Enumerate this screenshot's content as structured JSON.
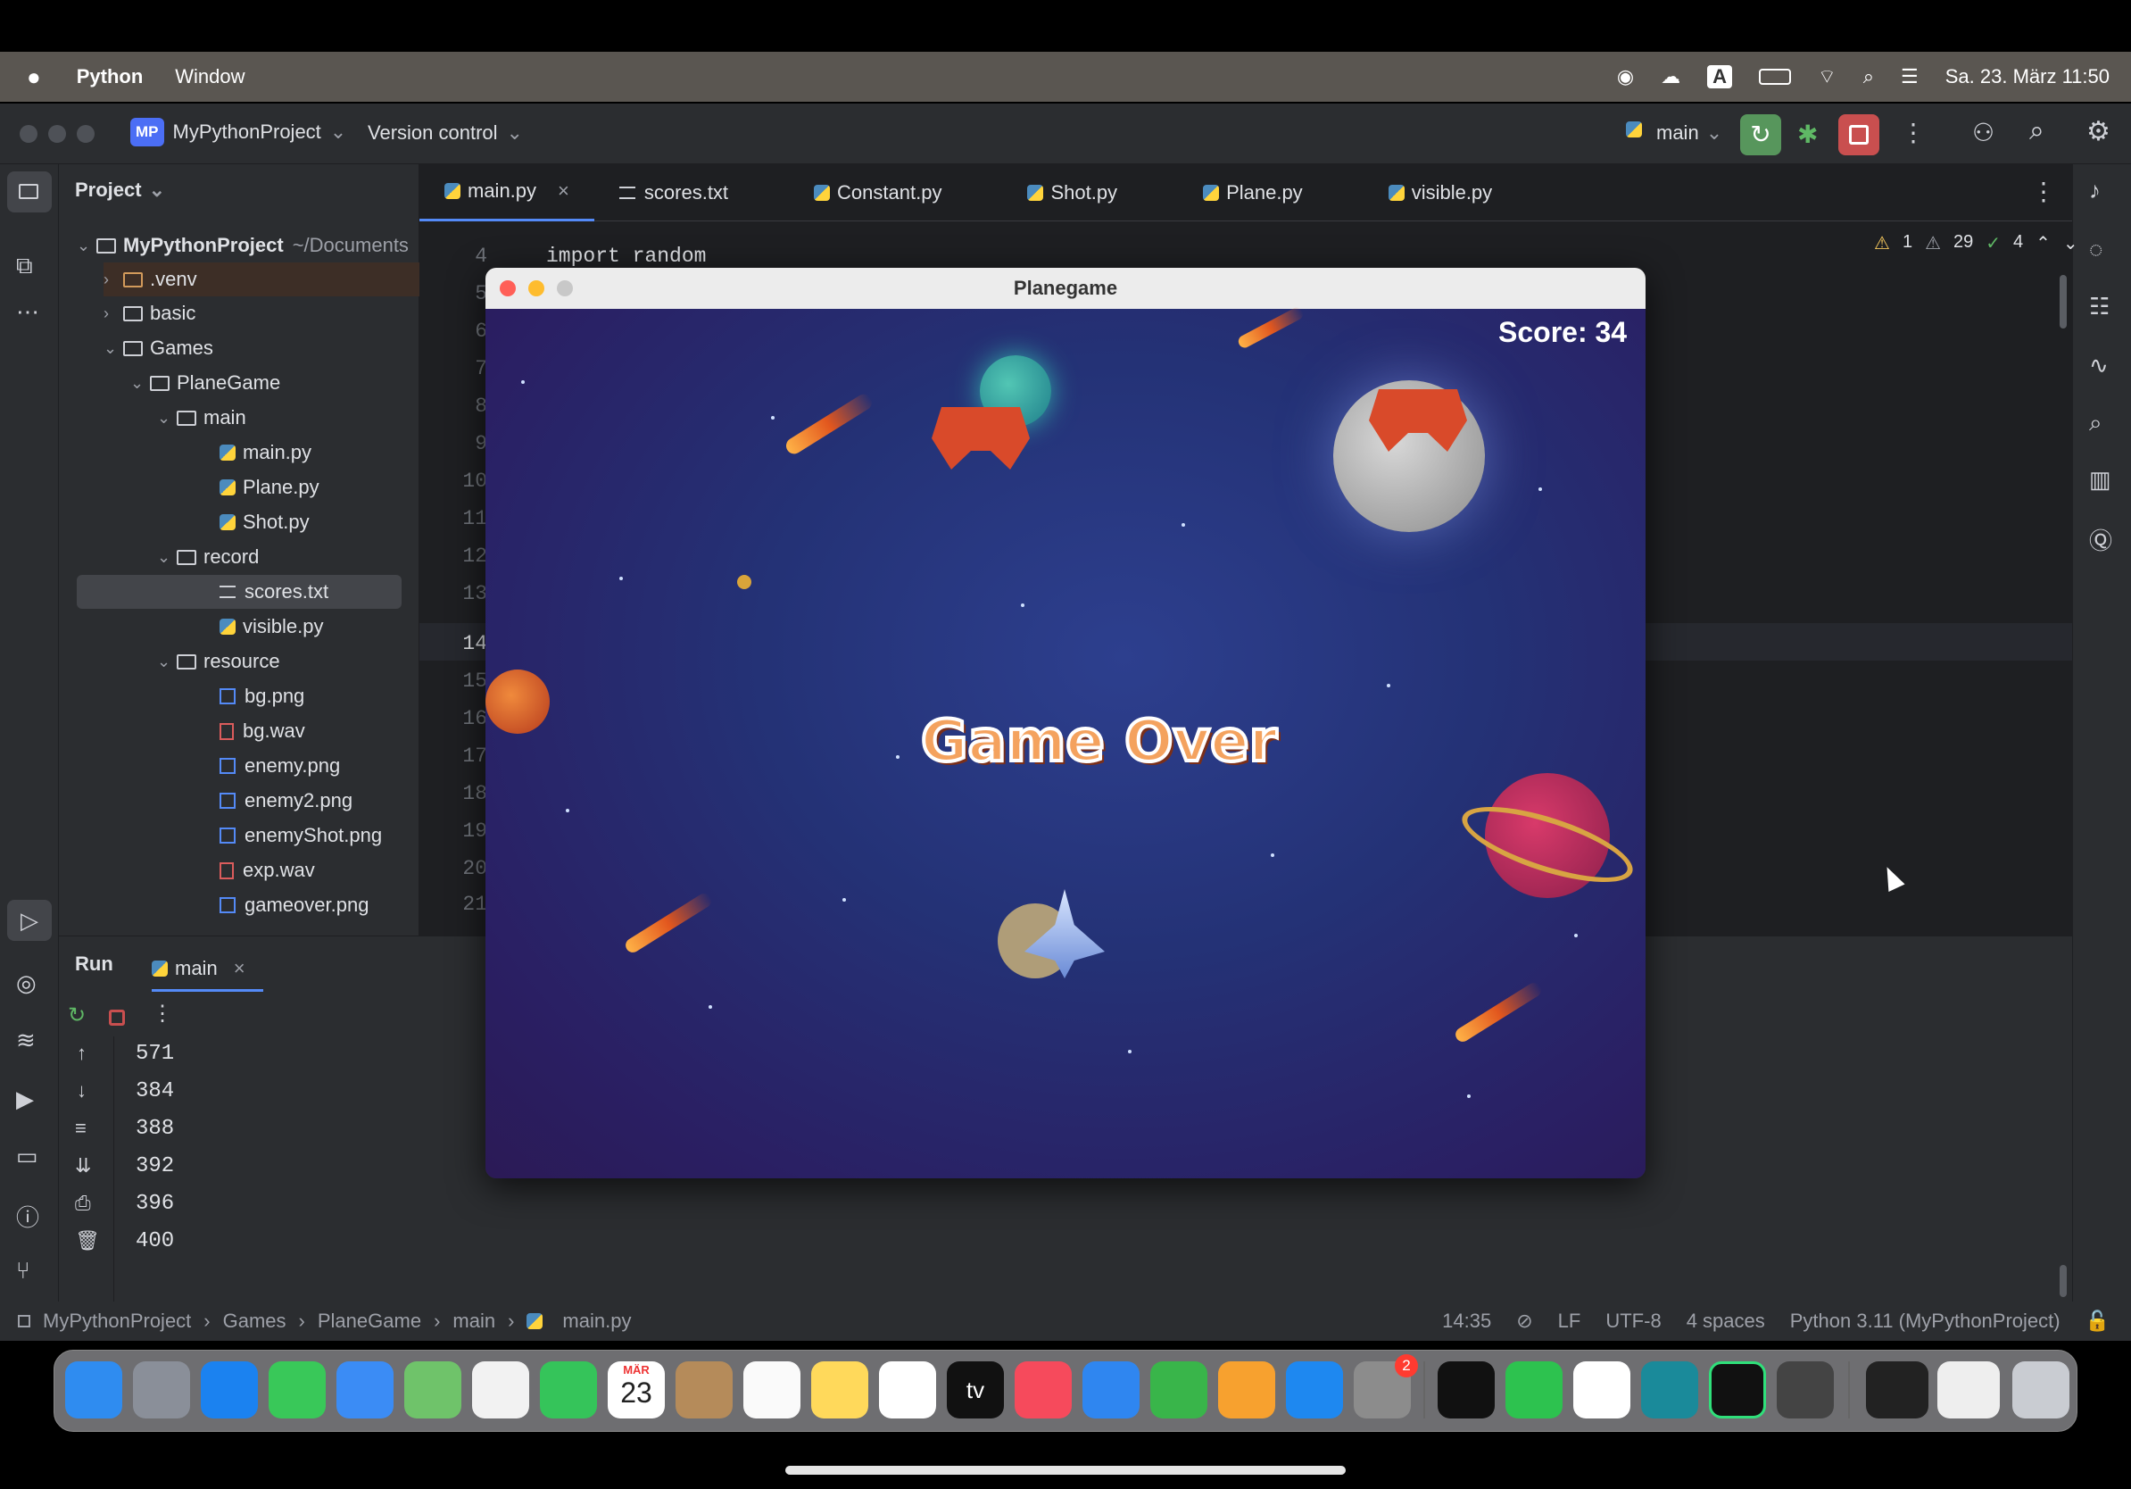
{
  "menubar": {
    "app": "Python",
    "window": "Window",
    "datetime": "Sa. 23. März 11:50",
    "input_indicator": "A"
  },
  "toolbar": {
    "project_badge": "MP",
    "project_name": "MyPythonProject",
    "vcs": "Version control",
    "branch": "main"
  },
  "project_panel": {
    "title": "Project",
    "root": "MyPythonProject",
    "root_path": "~/Documents",
    "items": [
      ".venv",
      "basic",
      "Games",
      "PlaneGame",
      "main",
      "main.py",
      "Plane.py",
      "Shot.py",
      "record",
      "scores.txt",
      "visible.py",
      "resource",
      "bg.png",
      "bg.wav",
      "enemy.png",
      "enemy2.png",
      "enemyShot.png",
      "exp.wav",
      "gameover.png"
    ]
  },
  "tabs": [
    "main.py",
    "scores.txt",
    "Constant.py",
    "Shot.py",
    "Plane.py",
    "visible.py"
  ],
  "editor": {
    "line_numbers": [
      "4",
      "5",
      "6",
      "7",
      "8",
      "9",
      "10",
      "11",
      "12",
      "13",
      "14",
      "15",
      "16",
      "17",
      "18",
      "19",
      "20",
      "21"
    ],
    "code_line_4": "import random",
    "inspections": {
      "warn1": "1",
      "warn2": "29",
      "ok": "4"
    }
  },
  "run_panel": {
    "title": "Run",
    "config": "main",
    "output": [
      "571",
      "384",
      "388",
      "392",
      "396",
      "400"
    ]
  },
  "status_bar": {
    "breadcrumb": [
      "MyPythonProject",
      "Games",
      "PlaneGame",
      "main",
      "main.py"
    ],
    "position": "14:35",
    "line_sep": "LF",
    "encoding": "UTF-8",
    "indent": "4 spaces",
    "interpreter": "Python 3.11 (MyPythonProject)"
  },
  "game_window": {
    "title": "Planegame",
    "score": "Score: 34",
    "banner": "Game Over"
  },
  "dock": {
    "calendar_month": "MÄR",
    "calendar_day": "23",
    "settings_badge": "2",
    "tv_label": "tv"
  }
}
